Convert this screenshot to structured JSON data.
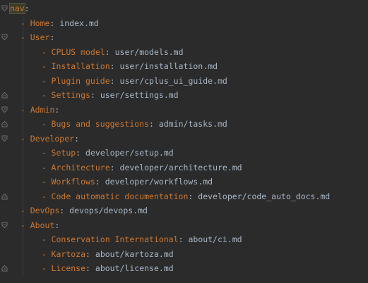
{
  "root_key": "nav",
  "items": [
    {
      "depth": 1,
      "key": "Home",
      "value": "index.md"
    },
    {
      "depth": 1,
      "key": "User",
      "value": ""
    },
    {
      "depth": 2,
      "key": "CPLUS model",
      "value": "user/models.md"
    },
    {
      "depth": 2,
      "key": "Installation",
      "value": "user/installation.md"
    },
    {
      "depth": 2,
      "key": "Plugin guide",
      "value": "user/cplus_ui_guide.md"
    },
    {
      "depth": 2,
      "key": "Settings",
      "value": "user/settings.md"
    },
    {
      "depth": 1,
      "key": "Admin",
      "value": ""
    },
    {
      "depth": 2,
      "key": "Bugs and suggestions",
      "value": "admin/tasks.md"
    },
    {
      "depth": 1,
      "key": "Developer",
      "value": ""
    },
    {
      "depth": 2,
      "key": "Setup",
      "value": "developer/setup.md"
    },
    {
      "depth": 2,
      "key": "Architecture",
      "value": "developer/architecture.md"
    },
    {
      "depth": 2,
      "key": "Workflows",
      "value": "developer/workflows.md"
    },
    {
      "depth": 2,
      "key": "Code automatic documentation",
      "value": "developer/code_auto_docs.md"
    },
    {
      "depth": 1,
      "key": "DevOps",
      "value": "devops/devops.md"
    },
    {
      "depth": 1,
      "key": "About",
      "value": ""
    },
    {
      "depth": 2,
      "key": "Conservation International",
      "value": "about/ci.md"
    },
    {
      "depth": 2,
      "key": "Kartoza",
      "value": "about/kartoza.md"
    },
    {
      "depth": 2,
      "key": "License",
      "value": "about/license.md"
    }
  ],
  "colors": {
    "background": "#2b2b2b",
    "key": "#cc7832",
    "text": "#a9b7c6",
    "fold_marker": "#6b6f72",
    "indent_guide": "#3c3f41"
  }
}
